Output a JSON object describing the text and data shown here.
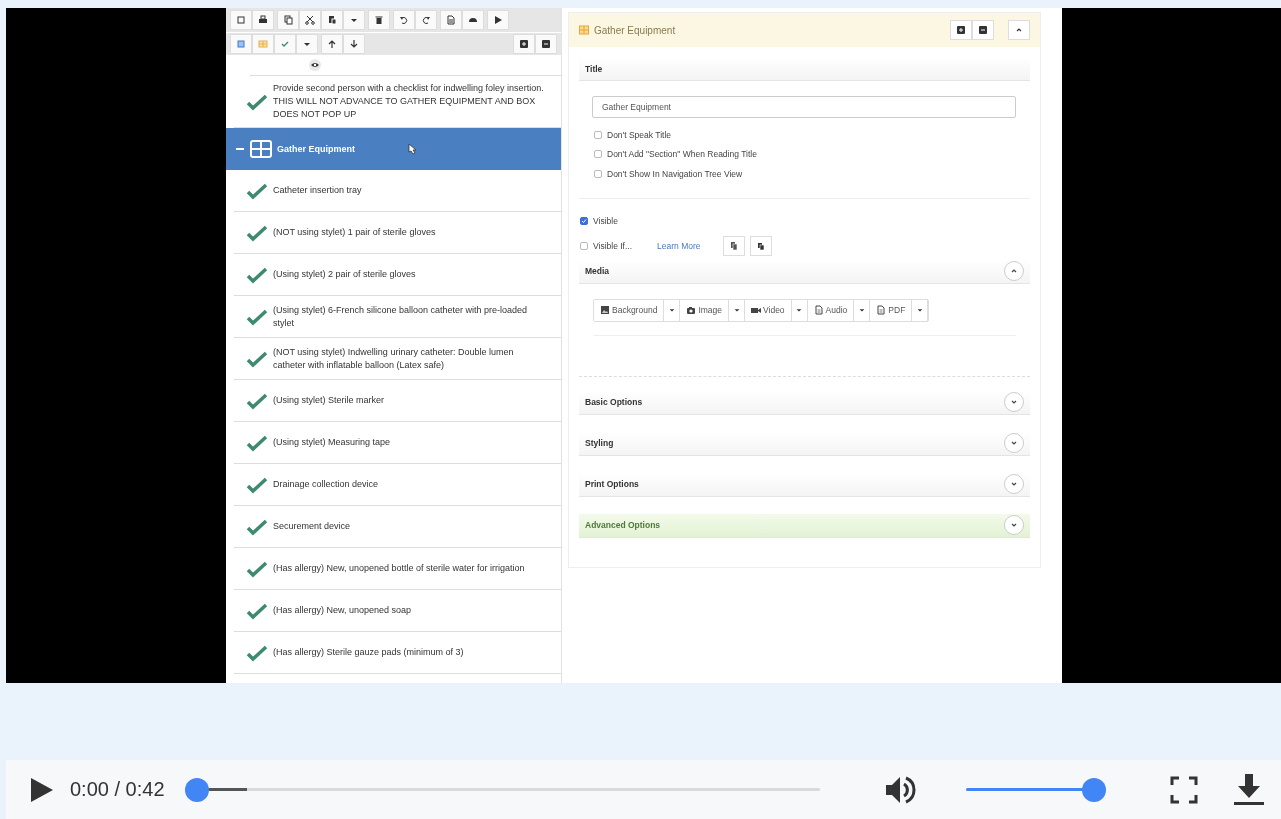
{
  "tree": {
    "items": [
      {
        "kind": "check",
        "text": "Provide second person with a checklist for indwelling foley insertion. THIS WILL NOT ADVANCE TO GATHER EQUIPMENT AND BOX DOES NOT POP UP",
        "selected": false
      },
      {
        "kind": "section",
        "text": "Gather Equipment",
        "selected": true,
        "expanded": true,
        "children": [
          {
            "kind": "check",
            "text": "Catheter insertion tray",
            "selected": false
          },
          {
            "kind": "check",
            "text": "(NOT using stylet) 1 pair of sterile gloves",
            "selected": false
          },
          {
            "kind": "check",
            "text": "(Using stylet) 2 pair of sterile gloves",
            "selected": false
          },
          {
            "kind": "check",
            "text": "(Using stylet) 6-French silicone balloon catheter with pre-loaded stylet",
            "selected": false
          },
          {
            "kind": "check",
            "text": "(NOT using stylet) Indwelling urinary catheter: Double lumen catheter with inflatable balloon (Latex safe)",
            "selected": false
          },
          {
            "kind": "check",
            "text": "(Using stylet) Sterile marker",
            "selected": false
          },
          {
            "kind": "check",
            "text": "(Using stylet) Measuring tape",
            "selected": false
          },
          {
            "kind": "check",
            "text": "Drainage collection device",
            "selected": false
          },
          {
            "kind": "check",
            "text": "Securement device",
            "selected": false
          },
          {
            "kind": "check",
            "text": "(Has allergy) New, unopened bottle of sterile water for irrigation",
            "selected": false
          },
          {
            "kind": "check",
            "text": "(Has allergy) New, unopened soap",
            "selected": false
          },
          {
            "kind": "check",
            "text": "(Has allergy) Sterile gauze pads (minimum of 3)",
            "selected": false
          }
        ]
      }
    ]
  },
  "editor": {
    "title": "Gather Equipment",
    "title_section": {
      "heading": "Title",
      "value": "Gather Equipment",
      "options": [
        {
          "label": "Don't Speak Title",
          "checked": false
        },
        {
          "label": "Don't Add \"Section\" When Reading Title",
          "checked": false
        },
        {
          "label": "Don't Show In Navigation Tree View",
          "checked": false
        }
      ]
    },
    "visible": {
      "label": "Visible",
      "checked": true
    },
    "visible_if": {
      "label": "Visible If...",
      "checked": false,
      "link": "Learn More"
    },
    "media": {
      "heading": "Media",
      "expanded": true,
      "buttons": [
        {
          "kind": "background",
          "label": "Background"
        },
        {
          "kind": "image",
          "label": "Image"
        },
        {
          "kind": "video",
          "label": "Video"
        },
        {
          "kind": "audio",
          "label": "Audio"
        },
        {
          "kind": "pdf",
          "label": "PDF"
        }
      ]
    },
    "sections": [
      {
        "heading": "Basic Options",
        "highlighted": false,
        "expanded": false
      },
      {
        "heading": "Styling",
        "highlighted": false,
        "expanded": false
      },
      {
        "heading": "Print Options",
        "highlighted": false,
        "expanded": false
      },
      {
        "heading": "Advanced Options",
        "highlighted": true,
        "expanded": false
      }
    ]
  },
  "player": {
    "time": "0:00 / 0:42",
    "progress": {
      "level": 0
    },
    "volume": {
      "level": 0.92
    }
  }
}
